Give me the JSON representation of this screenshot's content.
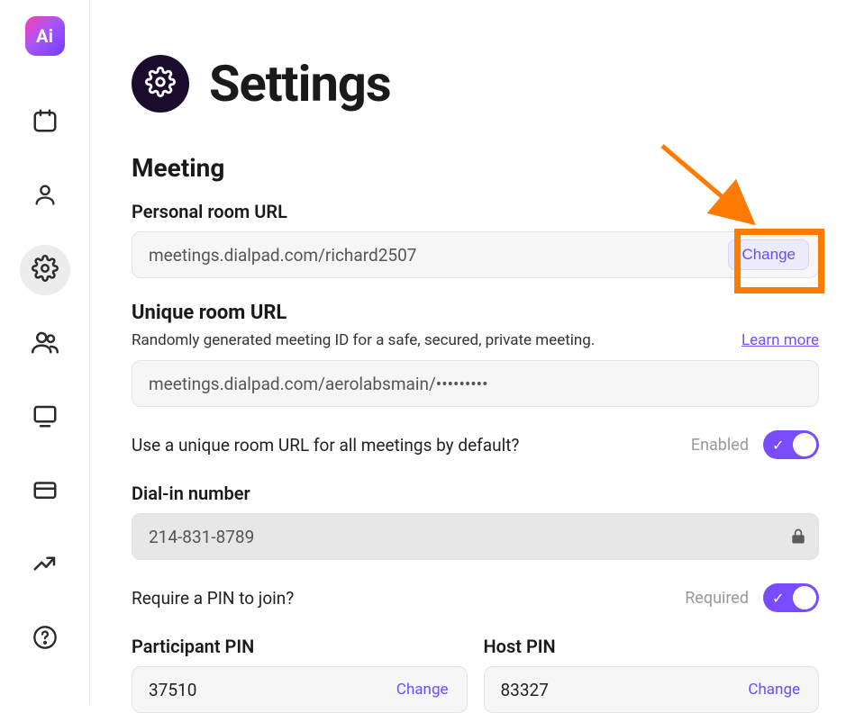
{
  "logo_text": "Ai",
  "page": {
    "title": "Settings",
    "section": "Meeting"
  },
  "personal_room": {
    "label": "Personal room URL",
    "value": "meetings.dialpad.com/richard2507",
    "change": "Change"
  },
  "unique_room": {
    "label": "Unique room URL",
    "helper": "Randomly generated meeting ID for a safe, secured, private meeting.",
    "learn_more": "Learn more",
    "value": "meetings.dialpad.com/aerolabsmain/•••••••••"
  },
  "unique_default": {
    "question": "Use a unique room URL for all meetings by default?",
    "state": "Enabled"
  },
  "dialin": {
    "label": "Dial-in number",
    "value": "214-831-8789"
  },
  "pin_req": {
    "question": "Require a PIN to join?",
    "state": "Required"
  },
  "pins": {
    "participant": {
      "label": "Participant PIN",
      "value": "37510",
      "change": "Change"
    },
    "host": {
      "label": "Host PIN",
      "value": "83327",
      "change": "Change"
    }
  }
}
